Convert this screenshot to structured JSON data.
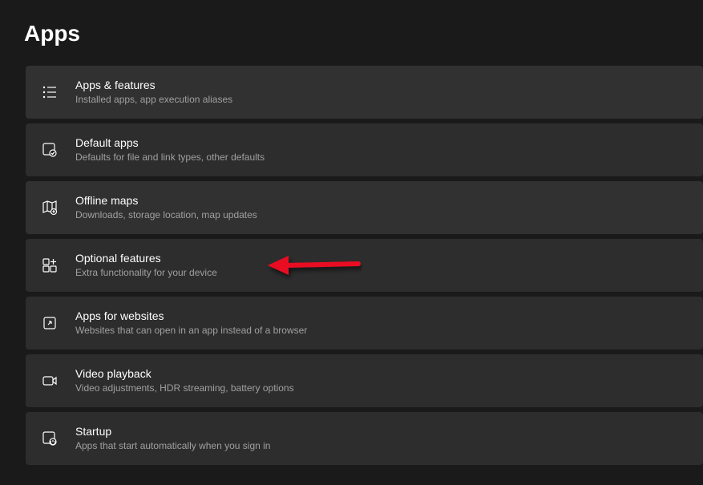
{
  "page": {
    "title": "Apps"
  },
  "items": [
    {
      "title": "Apps & features",
      "subtitle": "Installed apps, app execution aliases",
      "icon": "apps-features-icon"
    },
    {
      "title": "Default apps",
      "subtitle": "Defaults for file and link types, other defaults",
      "icon": "default-apps-icon"
    },
    {
      "title": "Offline maps",
      "subtitle": "Downloads, storage location, map updates",
      "icon": "offline-maps-icon"
    },
    {
      "title": "Optional features",
      "subtitle": "Extra functionality for your device",
      "icon": "optional-features-icon"
    },
    {
      "title": "Apps for websites",
      "subtitle": "Websites that can open in an app instead of a browser",
      "icon": "apps-websites-icon"
    },
    {
      "title": "Video playback",
      "subtitle": "Video adjustments, HDR streaming, battery options",
      "icon": "video-playback-icon"
    },
    {
      "title": "Startup",
      "subtitle": "Apps that start automatically when you sign in",
      "icon": "startup-icon"
    }
  ]
}
